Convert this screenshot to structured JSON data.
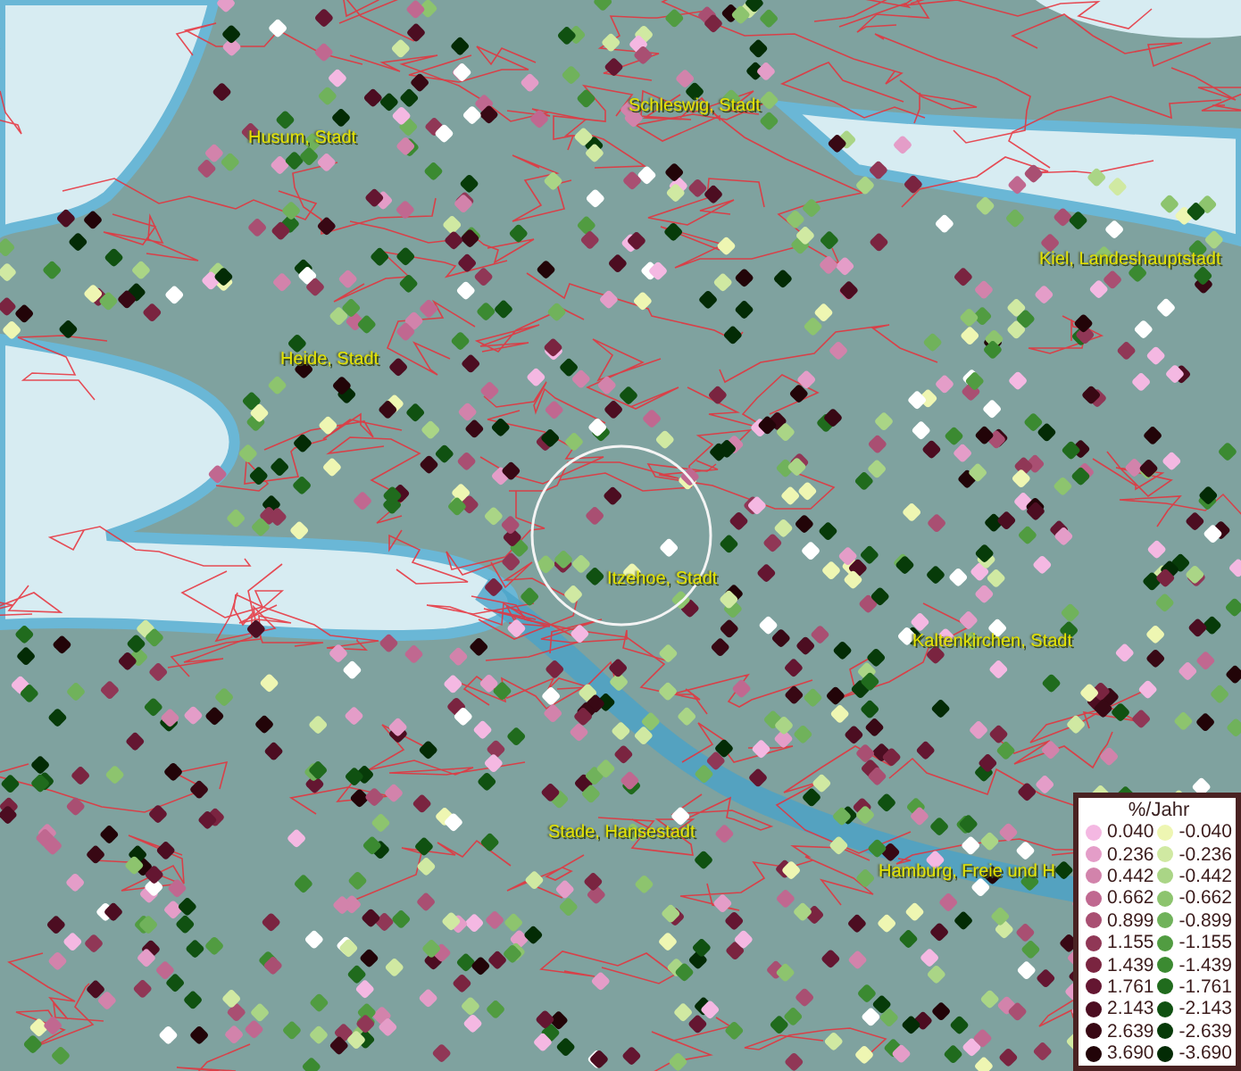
{
  "map": {
    "places": [
      {
        "name": "Husum, Stadt"
      },
      {
        "name": "Schleswig, Stadt"
      },
      {
        "name": "Kiel, Landeshauptstadt"
      },
      {
        "name": "Heide, Stadt"
      },
      {
        "name": "Itzehoe, Stadt"
      },
      {
        "name": "Kaltenkirchen, Stadt"
      },
      {
        "name": "Stade, Hansestadt"
      },
      {
        "name": "Hamburg, Freie und H"
      }
    ]
  },
  "legend": {
    "title": "%/Jahr",
    "positive": [
      {
        "label": "0.040",
        "color": "#f4b8e2"
      },
      {
        "label": "0.236",
        "color": "#e49dc8"
      },
      {
        "label": "0.442",
        "color": "#d283ab"
      },
      {
        "label": "0.662",
        "color": "#c06890"
      },
      {
        "label": "0.899",
        "color": "#a94f72"
      },
      {
        "label": "1.155",
        "color": "#903756"
      },
      {
        "label": "1.439",
        "color": "#7a2440"
      },
      {
        "label": "1.761",
        "color": "#641631"
      },
      {
        "label": "2.143",
        "color": "#4c0d21"
      },
      {
        "label": "2.639",
        "color": "#380814"
      },
      {
        "label": "3.690",
        "color": "#220408"
      }
    ],
    "negative": [
      {
        "label": "-0.040",
        "color": "#eef6b2"
      },
      {
        "label": "-0.236",
        "color": "#d0e9a2"
      },
      {
        "label": "-0.442",
        "color": "#aad586"
      },
      {
        "label": "-0.662",
        "color": "#8dc46e"
      },
      {
        "label": "-0.899",
        "color": "#70b25b"
      },
      {
        "label": "-1.155",
        "color": "#519c41"
      },
      {
        "label": "-1.439",
        "color": "#3b8a31"
      },
      {
        "label": "-1.761",
        "color": "#206b1d"
      },
      {
        "label": "-2.143",
        "color": "#105111"
      },
      {
        "label": "-2.639",
        "color": "#073b09"
      },
      {
        "label": "-3.690",
        "color": "#032b05"
      }
    ]
  }
}
